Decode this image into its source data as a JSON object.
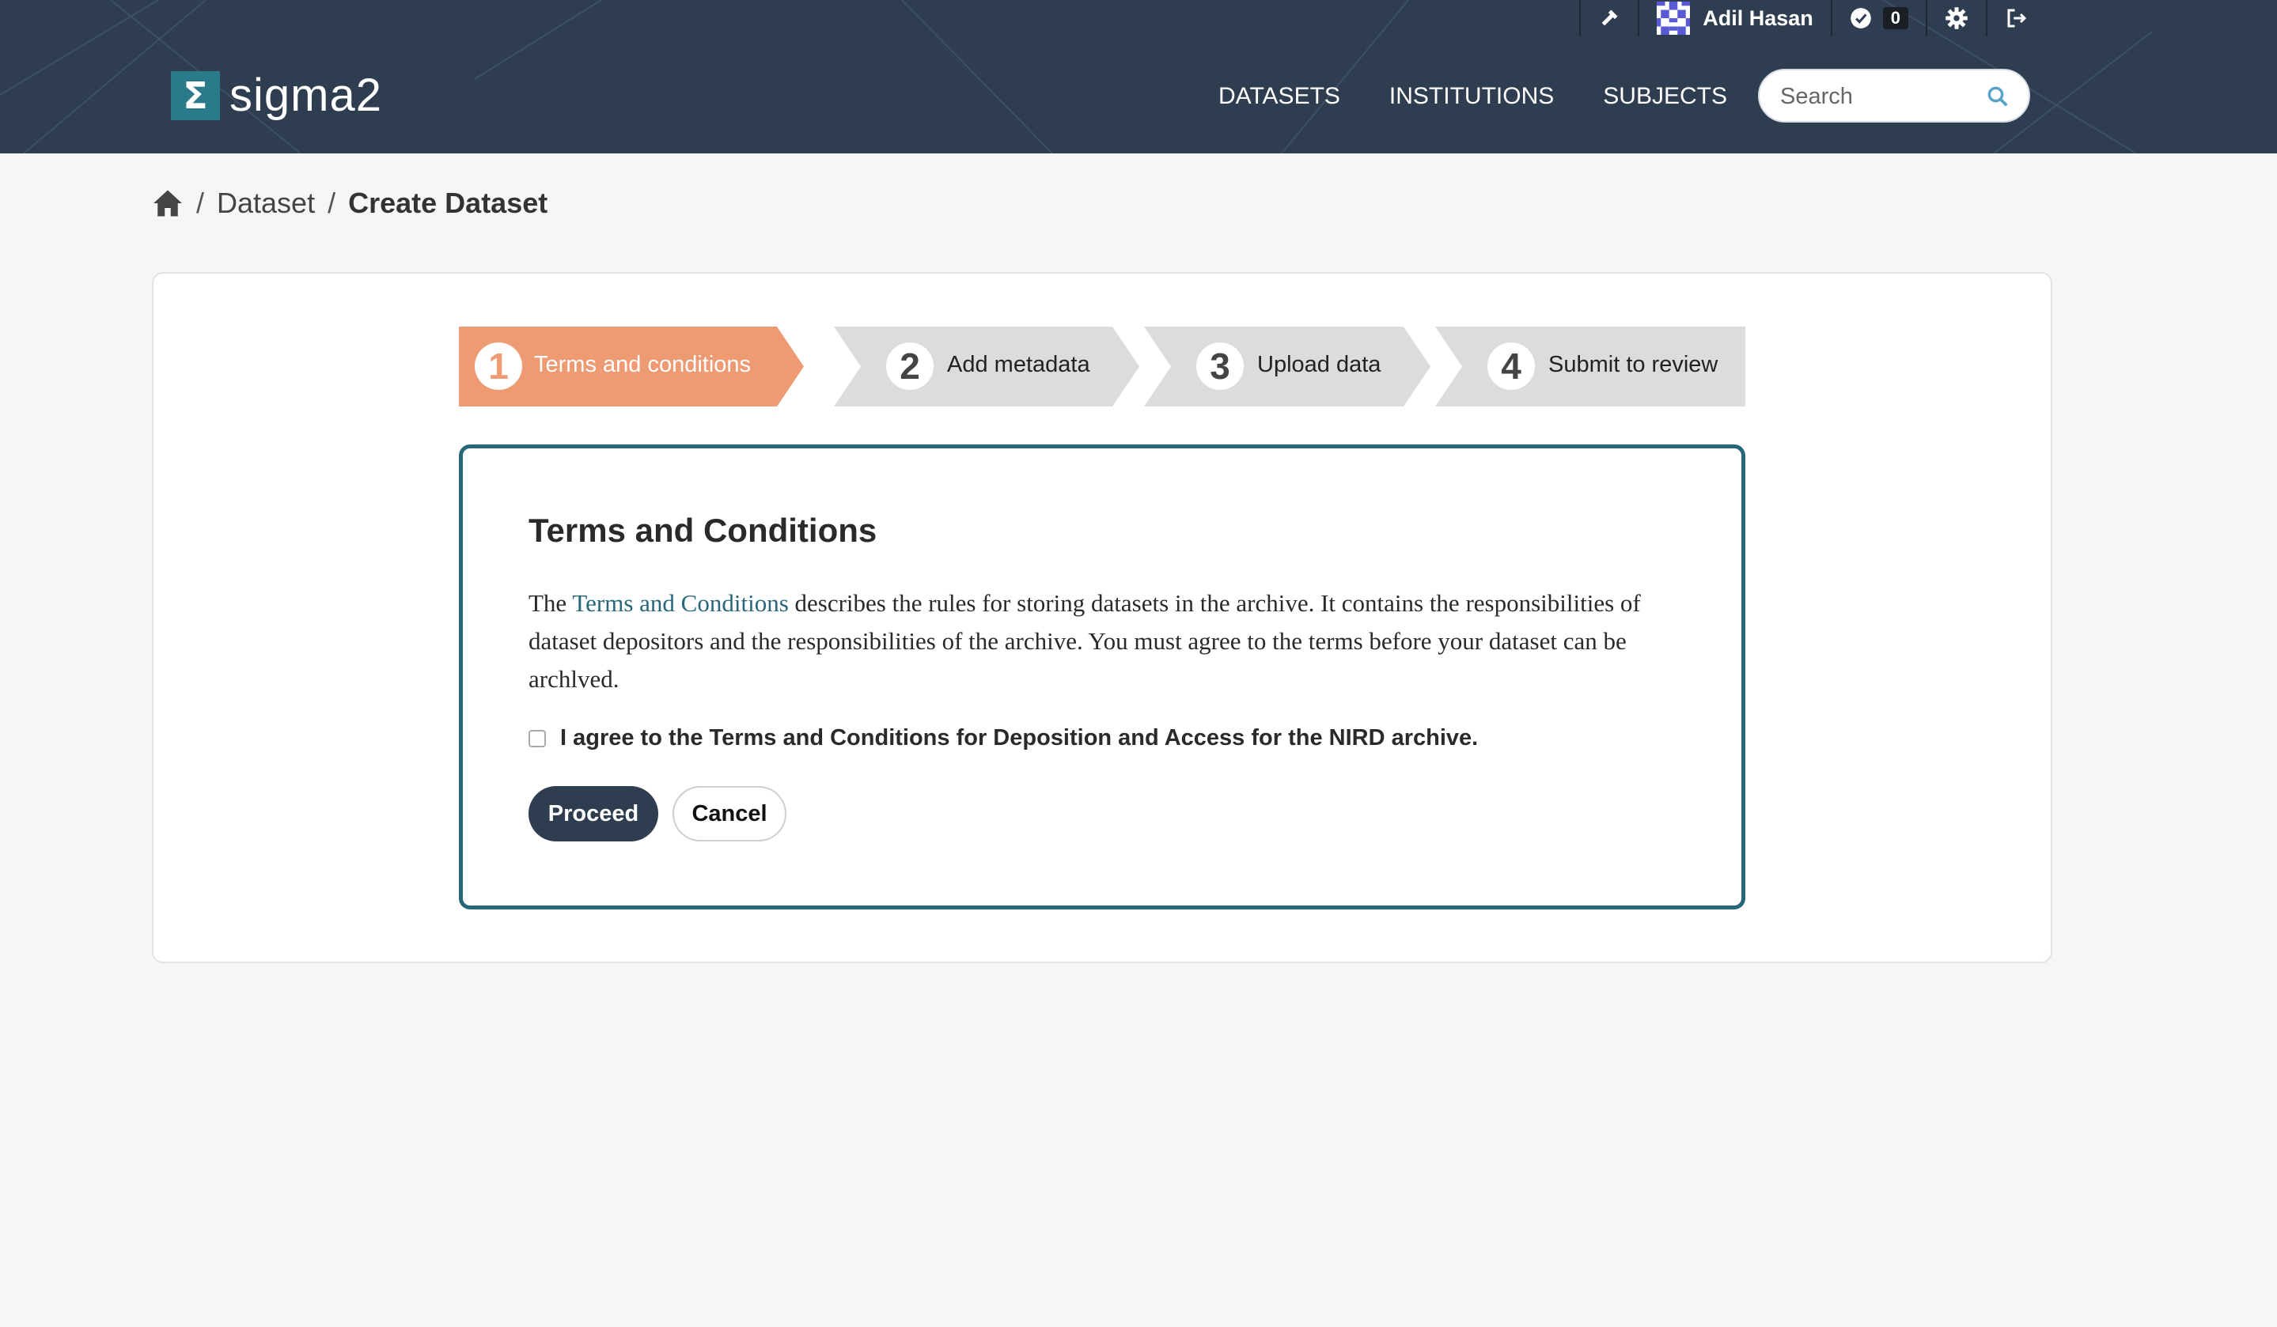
{
  "brand": {
    "logo_symbol": "Σ",
    "name": "sigma2"
  },
  "topbar": {
    "tools_icon": "hammer-icon",
    "user_name": "Adil Hasan",
    "notifications_count": "0",
    "settings_icon": "gear-icon",
    "logout_icon": "logout-icon"
  },
  "nav": {
    "items": [
      "DATASETS",
      "INSTITUTIONS",
      "SUBJECTS"
    ]
  },
  "search": {
    "placeholder": "Search"
  },
  "breadcrumb": {
    "home_icon": "home-icon",
    "items": [
      "Dataset",
      "Create Dataset"
    ],
    "separator": "/"
  },
  "steps": [
    {
      "number": "1",
      "label": "Terms and conditions",
      "active": true
    },
    {
      "number": "2",
      "label": "Add metadata",
      "active": false
    },
    {
      "number": "3",
      "label": "Upload data",
      "active": false
    },
    {
      "number": "4",
      "label": "Submit to review",
      "active": false
    }
  ],
  "terms": {
    "title": "Terms and Conditions",
    "text_before": "The ",
    "link_text": "Terms and Conditions",
    "text_after": " describes the rules for storing datasets in the archive. It contains the responsibilities of dataset depositors and the responsibilities of the archive. You must agree to the terms before your dataset can be archlved.",
    "agree_label": "I agree to the Terms and Conditions for Deposition and Access for the NIRD archive.",
    "proceed_label": "Proceed",
    "cancel_label": "Cancel"
  },
  "colors": {
    "header_bg": "#2e3d4f",
    "accent_teal": "#26677a",
    "logo_box": "#2b7a8c",
    "active_step": "#ee9a72",
    "inactive_step": "#dcdcdc"
  }
}
